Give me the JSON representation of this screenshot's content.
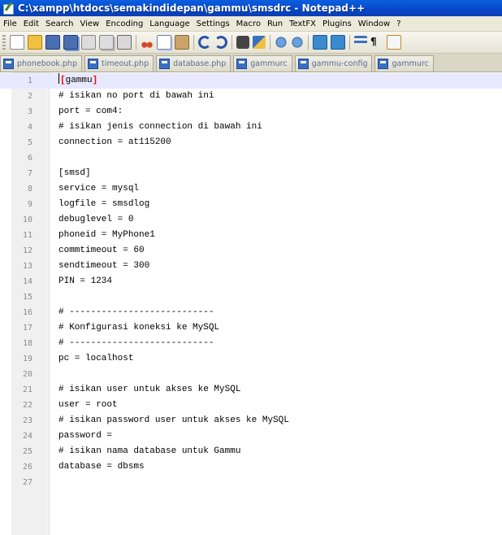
{
  "window": {
    "title": "C:\\xampp\\htdocs\\semakindidepan\\gammu\\smsdrc - Notepad++"
  },
  "menu": [
    "File",
    "Edit",
    "Search",
    "View",
    "Encoding",
    "Language",
    "Settings",
    "Macro",
    "Run",
    "TextFX",
    "Plugins",
    "Window",
    "?"
  ],
  "toolbar": {
    "buttons": [
      "new-file-icon",
      "open-file-icon",
      "save-icon",
      "save-all-icon",
      "close-icon",
      "close-all-icon",
      "print-icon",
      "cut-icon",
      "copy-icon",
      "paste-icon",
      "undo-icon",
      "redo-icon",
      "find-icon",
      "replace-icon",
      "zoom-in-icon",
      "zoom-out-icon",
      "sync-vertical-icon",
      "sync-horizontal-icon",
      "word-wrap-icon",
      "show-all-chars-icon",
      "indent-guide-icon"
    ]
  },
  "tabs": [
    {
      "label": "phonebook.php"
    },
    {
      "label": "timeout.php"
    },
    {
      "label": "database.php"
    },
    {
      "label": "gammurc"
    },
    {
      "label": "gammu-config"
    },
    {
      "label": "gammurc"
    }
  ],
  "editor": {
    "active_line": 1,
    "lines": [
      "[gammu]",
      "# isikan no port di bawah ini",
      "port = com4:",
      "# isikan jenis connection di bawah ini",
      "connection = at115200",
      "",
      "[smsd]",
      "service = mysql",
      "logfile = smsdlog",
      "debuglevel = 0",
      "phoneid = MyPhone1",
      "commtimeout = 60",
      "sendtimeout = 300",
      "PIN = 1234",
      "",
      "# ---------------------------",
      "# Konfigurasi koneksi ke MySQL",
      "# ---------------------------",
      "pc = localhost",
      "",
      "# isikan user untuk akses ke MySQL",
      "user = root",
      "# isikan password user untuk akses ke MySQL",
      "password =",
      "# isikan nama database untuk Gammu",
      "database = dbsms",
      ""
    ]
  },
  "colors": {
    "title_bar": "#0846c8",
    "active_line": "#e8e8ff",
    "bracket": "#ff0000"
  }
}
